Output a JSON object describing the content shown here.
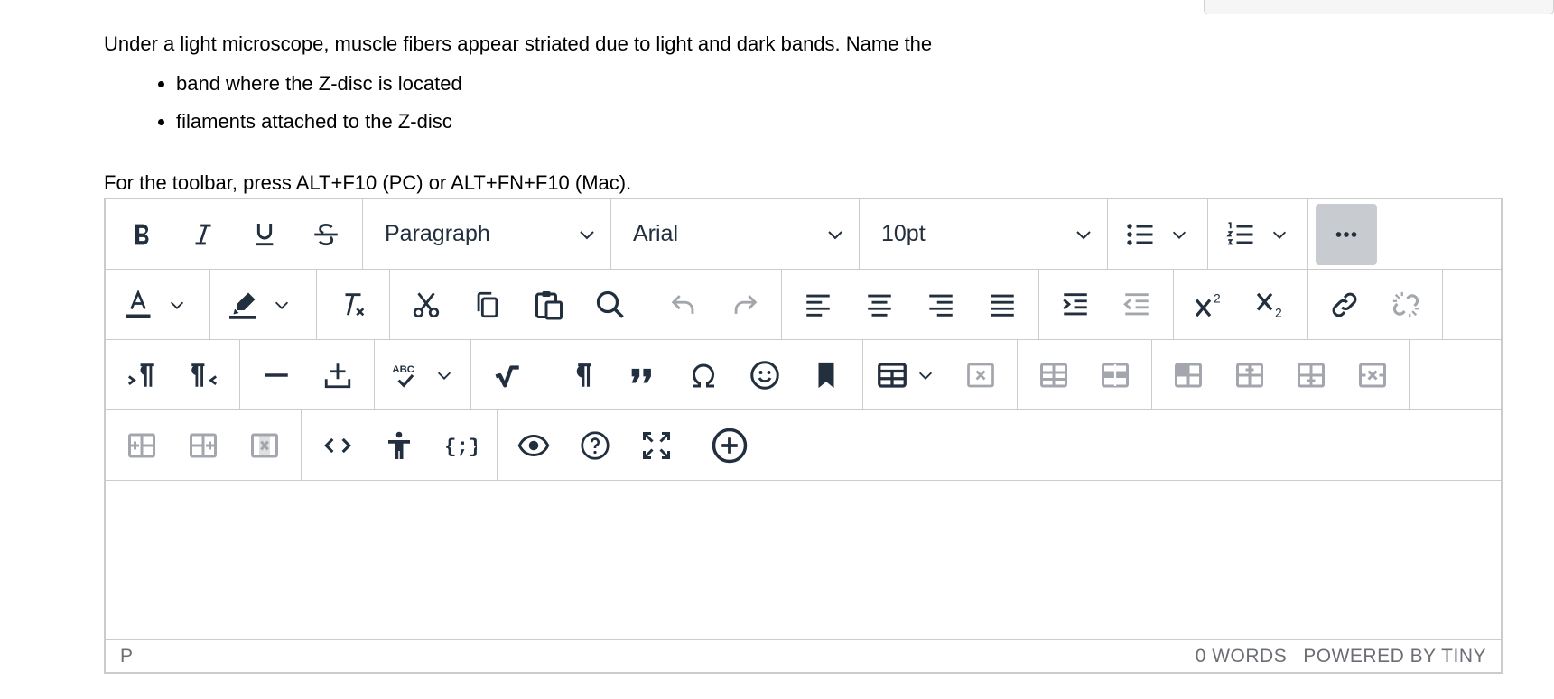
{
  "question": {
    "intro": "Under a light microscope, muscle fibers appear striated due to light and dark bands. Name the",
    "items": [
      "band where the Z-disc is located",
      "filaments attached to the Z-disc"
    ]
  },
  "hint": "For the toolbar, press ALT+F10 (PC) or ALT+FN+F10 (Mac).",
  "toolbar": {
    "block_format": "Paragraph",
    "font_family": "Arial",
    "font_size": "10pt"
  },
  "statusbar": {
    "path": "P",
    "word_count": "0 WORDS",
    "powered_by": "POWERED BY TINY"
  }
}
